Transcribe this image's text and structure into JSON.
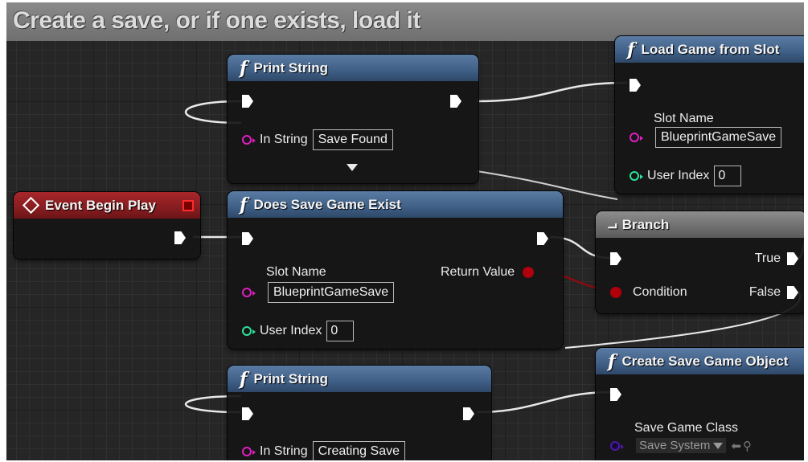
{
  "comment": {
    "title": "Create a save, or if one exists, load it"
  },
  "nodes": {
    "print_string_1": {
      "title": "Print String",
      "in_string_label": "In String",
      "in_string_value": "Save Found"
    },
    "load_game": {
      "title": "Load Game from Slot",
      "slot_name_label": "Slot Name",
      "slot_name_value": "BlueprintGameSave",
      "user_index_label": "User Index",
      "user_index_value": "0"
    },
    "event_begin_play": {
      "title": "Event Begin Play"
    },
    "does_save_exist": {
      "title": "Does Save Game Exist",
      "slot_name_label": "Slot Name",
      "slot_name_value": "BlueprintGameSave",
      "user_index_label": "User Index",
      "user_index_value": "0",
      "return_label": "Return Value"
    },
    "branch": {
      "title": "Branch",
      "true_label": "True",
      "false_label": "False",
      "condition_label": "Condition"
    },
    "create_save": {
      "title": "Create Save Game Object",
      "class_label": "Save Game Class",
      "class_value": "Save System"
    },
    "print_string_2": {
      "title": "Print String",
      "in_string_label": "In String",
      "in_string_value": "Creating Save"
    }
  },
  "colors": {
    "function_header": "#4a6a92",
    "event_header": "#9a2226",
    "branch_header": "#7a7a7a",
    "exec_pin": "#ffffff",
    "string_pin": "#e21ec2",
    "int_pin": "#2be39a",
    "bool_pin": "#b0000c",
    "class_pin": "#4c1ba8"
  }
}
